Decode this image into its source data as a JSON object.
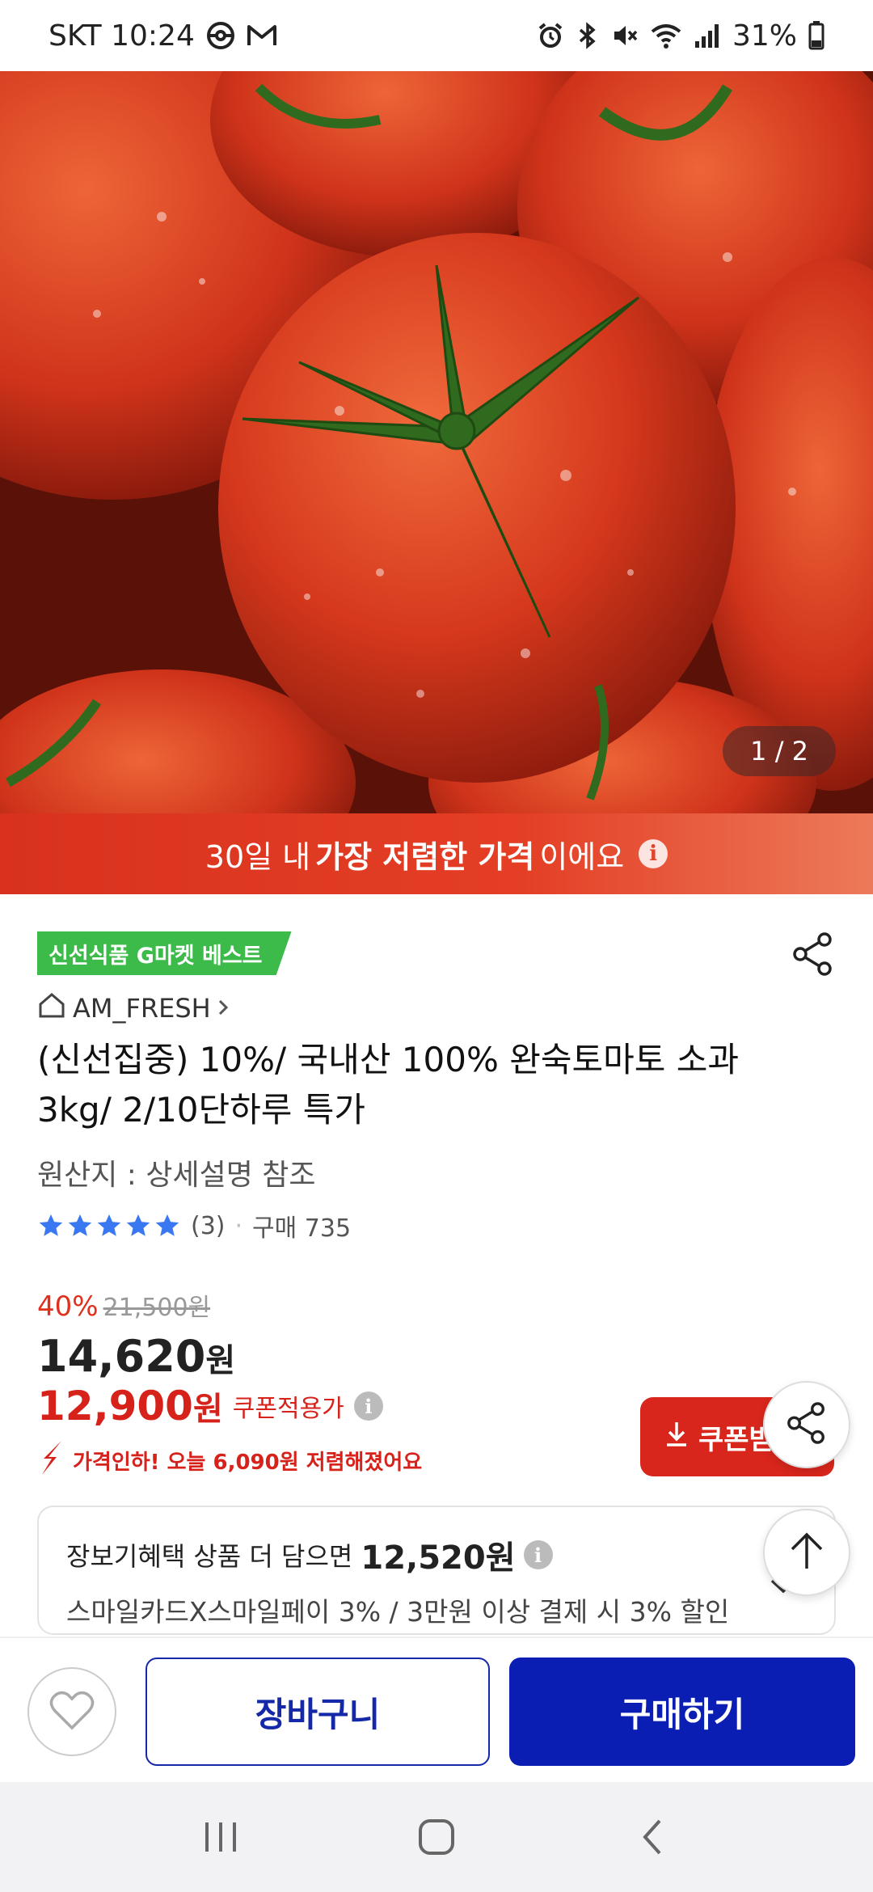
{
  "status_bar": {
    "carrier_time": "SKT 10:24",
    "battery": "31%",
    "icons": [
      "pokeball-icon",
      "gmail-icon",
      "alarm-icon",
      "bluetooth-icon",
      "mute-icon",
      "wifi-icon",
      "signal-icon",
      "battery-icon"
    ]
  },
  "hero": {
    "page_indicator": "1 / 2",
    "banner_prefix": "30일 내 ",
    "banner_bold": "가장 저렴한 가격",
    "banner_suffix": "이에요"
  },
  "product": {
    "badge": "신선식품 G마켓 베스트",
    "seller": "AM_FRESH",
    "title": "(신선집중) 10%/ 국내산 100% 완숙토마토 소과 3kg/ 2/10단하루 특가",
    "origin": "원산지 : 상세설명 참조",
    "rating": 5,
    "review_count": "(3)",
    "purchase_count": "구매 735"
  },
  "pricing": {
    "discount": "40%",
    "original_price": "21,500원",
    "sale_price": "14,620",
    "sale_won": "원",
    "coupon_price": "12,900",
    "coupon_won": "원",
    "coupon_label": "쿠폰적용가",
    "price_drop": "가격인하! 오늘 6,090원 저렴해졌어요",
    "coupon_button": "쿠폰받기"
  },
  "benefit": {
    "line1_prefix": "장보기혜택 상품 더 담으면",
    "amount": "12,520원",
    "line2": "스마일카드X스마일페이 3% / 3만원 이상 결제 시 3% 할인"
  },
  "actions": {
    "cart": "장바구니",
    "buy": "구매하기"
  },
  "colors": {
    "accent_red": "#d8261c",
    "buy_blue": "#0a1eb4",
    "badge_green": "#3dbb4a",
    "star_blue": "#3a78f2"
  }
}
